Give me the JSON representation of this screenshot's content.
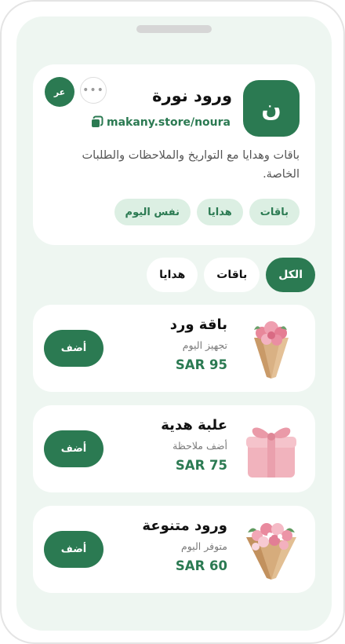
{
  "store": {
    "avatar_letter": "ن",
    "name": "ورود نورة",
    "url": "makany.store/noura",
    "description": "باقات وهدايا مع التواريخ والملاحظات والطلبات الخاصة.",
    "more_label": "•••",
    "lang_label": "عر",
    "chips": [
      {
        "label": "باقات"
      },
      {
        "label": "هدايا"
      },
      {
        "label": "نفس اليوم"
      }
    ]
  },
  "tabs": [
    {
      "label": "الكل",
      "active": true
    },
    {
      "label": "باقات",
      "active": false
    },
    {
      "label": "هدايا",
      "active": false
    }
  ],
  "products": [
    {
      "name": "باقة ورد",
      "note": "تجهيز اليوم",
      "price": "SAR 95",
      "add_label": "أضف",
      "icon": "flower-bouquet-icon"
    },
    {
      "name": "علبة هدية",
      "note": "أضف ملاحظة",
      "price": "SAR 75",
      "add_label": "أضف",
      "icon": "gift-box-icon"
    },
    {
      "name": "ورود متنوعة",
      "note": "متوفر اليوم",
      "price": "SAR 60",
      "add_label": "أضف",
      "icon": "mixed-flowers-icon"
    }
  ],
  "colors": {
    "brand_green": "#2b7a52",
    "chip_bg": "#dcefe3",
    "screen_bg": "#eef6f1"
  }
}
